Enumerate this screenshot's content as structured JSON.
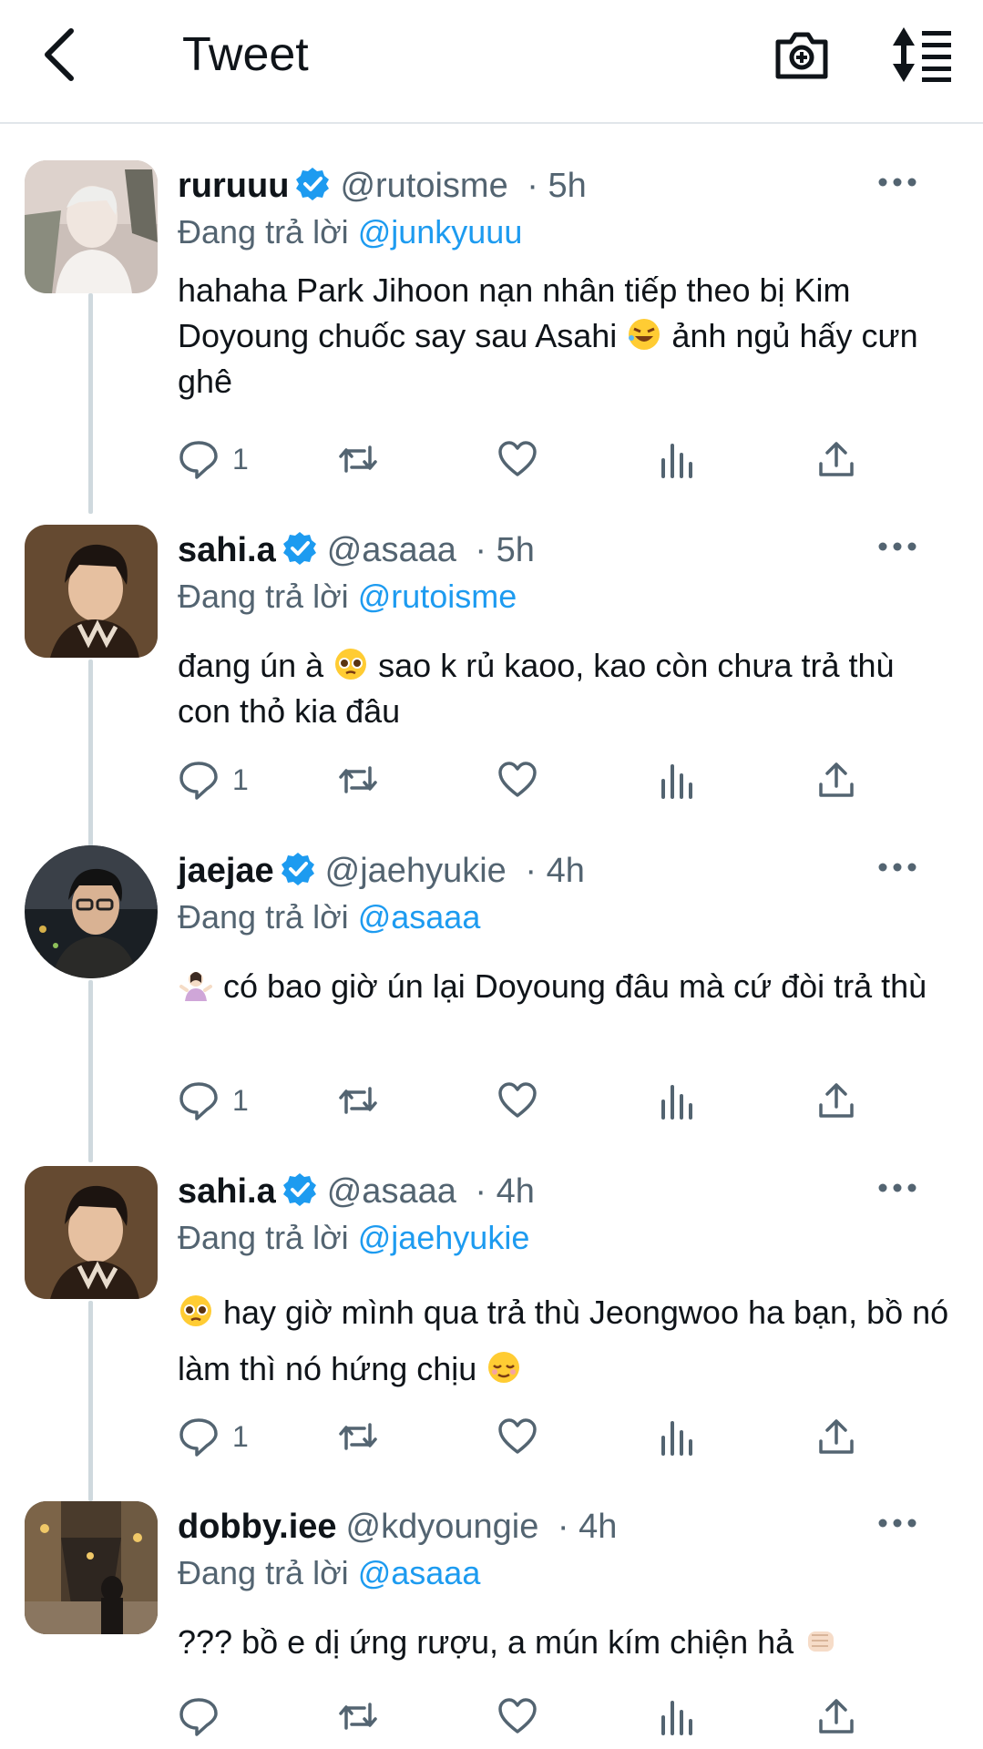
{
  "header": {
    "title": "Tweet"
  },
  "reply_prefix": "Đang trả lời",
  "tweets": [
    {
      "name": "ruruuu",
      "handle": "@rutoisme",
      "time": "5h",
      "verified": true,
      "reply_to": "@junkyuuu",
      "text_a": "hahaha Park Jihoon nạn nhân tiếp theo bị Kim Doyoung chuốc say sau Asahi ",
      "text_b": " ảnh ngủ hấy cưn ghê",
      "reply_count": "1"
    },
    {
      "name": "sahi.a",
      "handle": "@asaaa",
      "time": "5h",
      "verified": true,
      "reply_to": "@rutoisme",
      "text_a": "đang ún à ",
      "text_b": " sao k rủ kaoo, kao còn chưa trả thù con thỏ kia đâu",
      "reply_count": "1"
    },
    {
      "name": "jaejae",
      "handle": "@jaehyukie",
      "time": "4h",
      "verified": true,
      "reply_to": "@asaaa",
      "text_a": "",
      "text_b": " có bao giờ ún lại Doyoung đâu mà cứ đòi trả thù",
      "reply_count": "1"
    },
    {
      "name": "sahi.a",
      "handle": "@asaaa",
      "time": "4h",
      "verified": true,
      "reply_to": "@jaehyukie",
      "text_a": "",
      "text_b": " hay giờ mình qua trả thù Jeongwoo ha bạn, bồ nó làm thì nó hứng chịu ",
      "reply_count": "1"
    },
    {
      "name": "dobby.iee",
      "handle": "@kdyoungie",
      "time": "4h",
      "verified": false,
      "reply_to": "@asaaa",
      "text_a": "??? bồ e dị ứng rượu, a mún kím chiện hả ",
      "text_b": "",
      "reply_count": ""
    }
  ],
  "colors": {
    "accent": "#1d9bf0",
    "muted": "#536471",
    "line": "#cfd9de"
  }
}
